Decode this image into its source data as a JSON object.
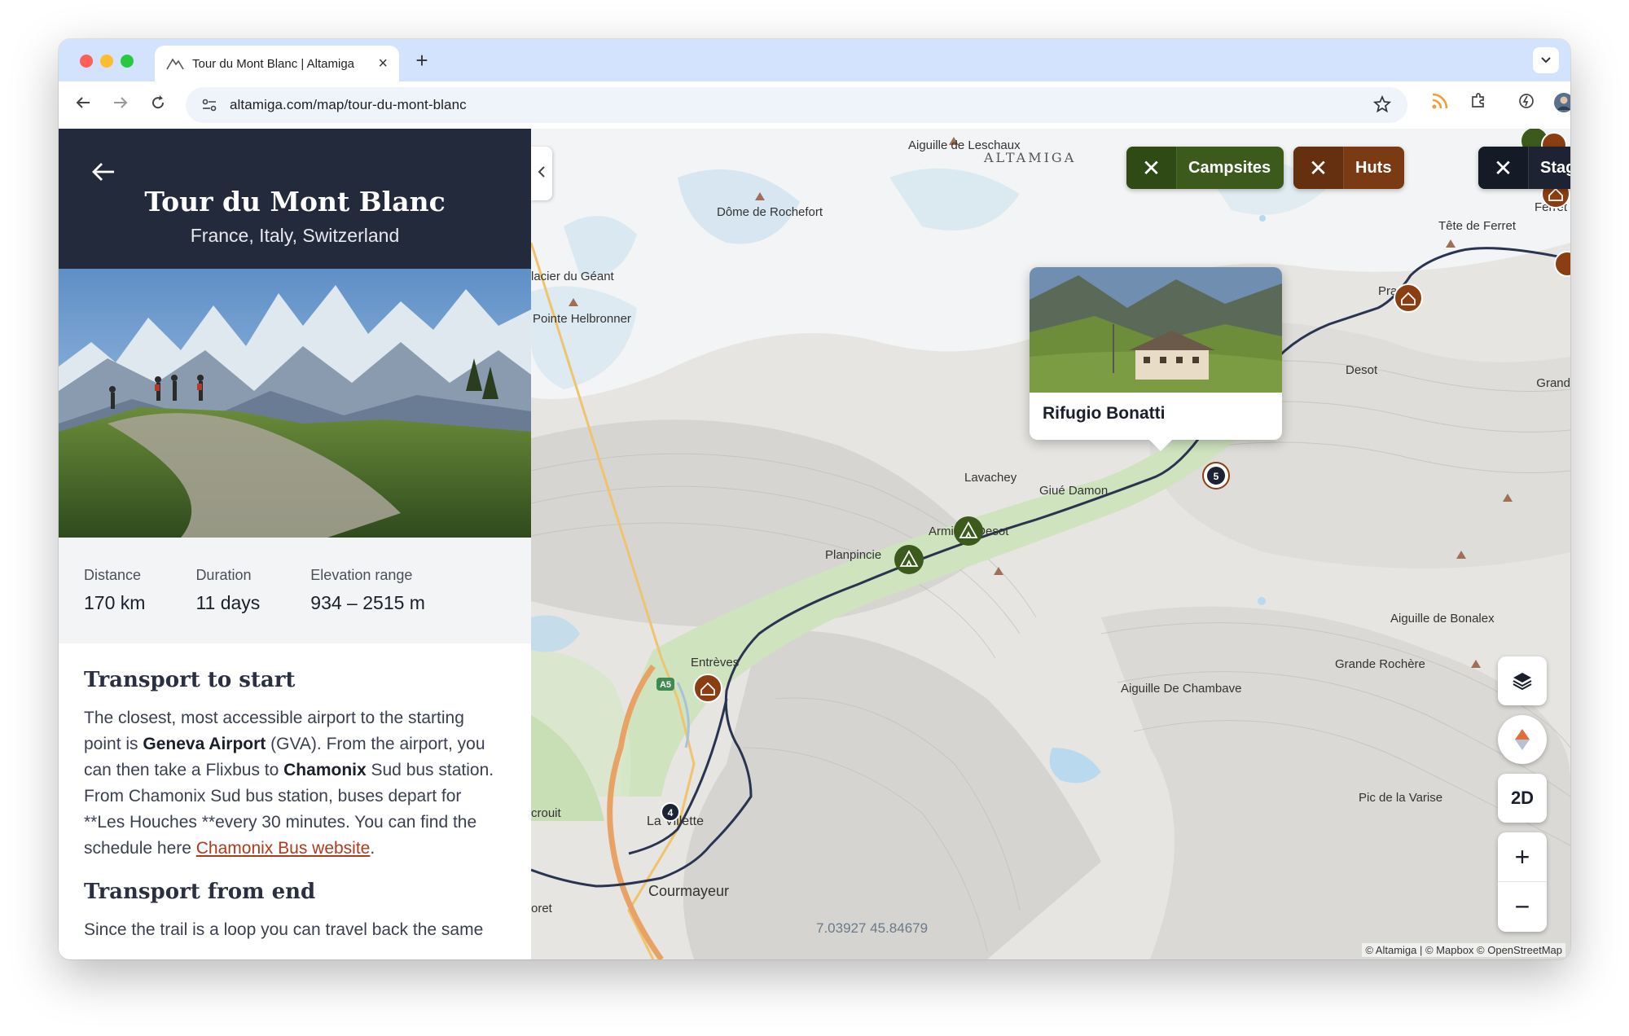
{
  "browser": {
    "tab_title": "Tour du Mont Blanc | Altamiga",
    "tab_close": "×",
    "new_tab": "+",
    "url": "altamiga.com/map/tour-du-mont-blanc"
  },
  "trail": {
    "title": "Tour du Mont Blanc",
    "subtitle": "France, Italy, Switzerland"
  },
  "stats": [
    {
      "label": "Distance",
      "value": "170 km"
    },
    {
      "label": "Duration",
      "value": "11 days"
    },
    {
      "label": "Elevation range",
      "value": "934 – 2515 m"
    }
  ],
  "sections": {
    "start_heading": "Transport to start",
    "start_text_1": "The closest, most accessible airport to the starting point is ",
    "start_bold_1": "Geneva Airport",
    "start_text_2": " (GVA). From the airport, you can then take a Flixbus to ",
    "start_bold_2": "Chamonix",
    "start_text_3": " Sud bus station. From Chamonix Sud bus station, buses depart for **Les Houches **every 30 minutes. You can find the schedule here ",
    "start_link": "Chamonix Bus website",
    "start_text_4": ".",
    "end_heading": "Transport from end",
    "end_text": "Since the trail is a loop you can travel back the same"
  },
  "map": {
    "filters": {
      "campsites": "Campsites",
      "huts": "Huts",
      "stages": "Stages",
      "clear_symbol": "✕"
    },
    "popup_name": "Rifugio Bonatti",
    "brand_label": "ALTAMIGA",
    "labels": {
      "leschaux": "Aiguille de Leschaux",
      "rochefort": "Dôme de Rochefort",
      "geant": "lacier du Géant",
      "helbronner": "Pointe Helbronner",
      "ferret_head": "Tête de Ferret",
      "ferret": "Ferret",
      "prabar": "Pra Bar",
      "desot": "Desot",
      "grand": "Grand",
      "lavachey": "Lavachey",
      "giue": "Giué Damon",
      "arminaz": "Arminaz Desot",
      "planpincieux": "Planpincie",
      "entreves": "Entrèves",
      "a5": "A5",
      "bonalex": "Aiguille de Bonalex",
      "grande_rochere": "Grande Rochère",
      "chambave": "Aiguille De Chambave",
      "varise": "Pic de la Varise",
      "lavillette": "La Villette",
      "courmayeur": "Courmayeur",
      "crouit": "crouit",
      "oret": "oret"
    },
    "stage_markers": [
      "5",
      "4"
    ],
    "controls": {
      "view_mode": "2D",
      "zoom_in": "+",
      "zoom_out": "−"
    },
    "coordinates": "7.03927 45.84679",
    "attribution": "© Altamiga | © Mapbox © OpenStreetMap"
  },
  "colors": {
    "header_bg": "#232a3b",
    "campsite": "#3b5a1c",
    "hut": "#7a3b14",
    "stage": "#1d2333",
    "link": "#b13a1c",
    "trail_line": "#2a3450"
  }
}
